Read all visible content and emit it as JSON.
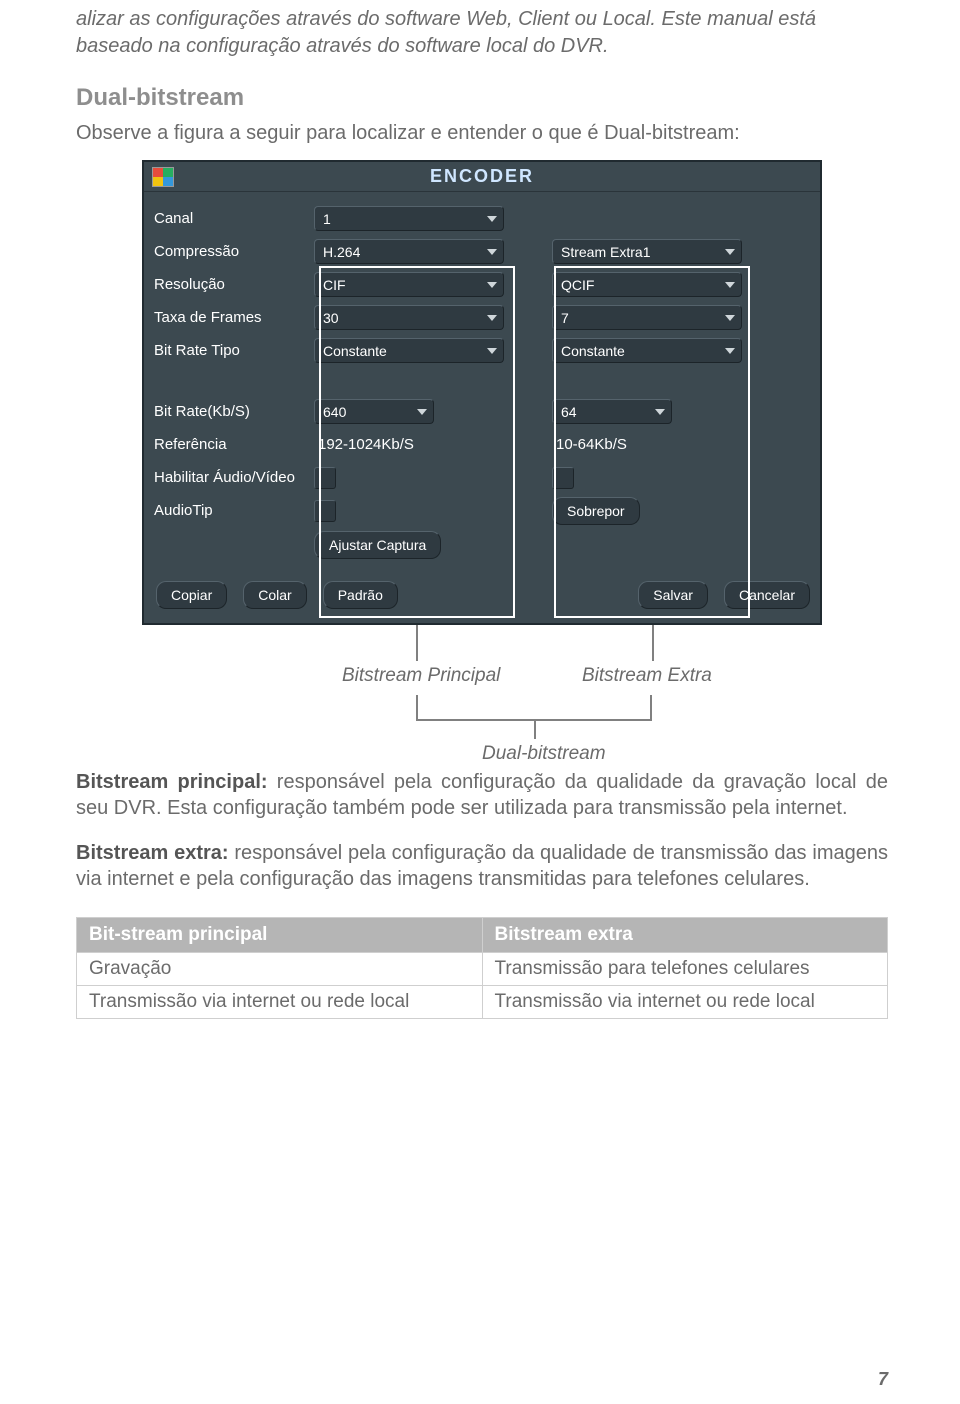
{
  "intro": "alizar as configurações através do software Web, Client ou Local. Este manual está baseado na configuração através do software local do DVR.",
  "section_title": "Dual-bitstream",
  "lead": "Observe a figura a seguir para localizar e entender o que é Dual-bitstream:",
  "encoder": {
    "title": "ENCODER",
    "labels": {
      "canal": "Canal",
      "compressao": "Compressão",
      "resolucao": "Resolução",
      "taxa_frames": "Taxa de Frames",
      "bitrate_tipo": "Bit Rate Tipo",
      "bitrate_kbs": "Bit Rate(Kb/S)",
      "referencia": "Referência",
      "hab_av": "Habilitar Áudio/Vídeo",
      "audiotip": "AudioTip"
    },
    "col1": {
      "canal": "1",
      "compressao": "H.264",
      "resolucao": "CIF",
      "taxa_frames": "30",
      "bitrate_tipo": "Constante",
      "bitrate_kbs": "640",
      "referencia": "192-1024Kb/S"
    },
    "col2": {
      "stream": "Stream Extra1",
      "resolucao": "QCIF",
      "taxa_frames": "7",
      "bitrate_tipo": "Constante",
      "bitrate_kbs": "64",
      "referencia": "10-64Kb/S",
      "sobrepor": "Sobrepor"
    },
    "buttons": {
      "ajustar": "Ajustar Captura",
      "copiar": "Copiar",
      "colar": "Colar",
      "padrao": "Padrão",
      "salvar": "Salvar",
      "cancelar": "Cancelar"
    }
  },
  "callouts": {
    "principal": "Bitstream Principal",
    "extra": "Bitstream Extra",
    "dual": "Dual-bitstream"
  },
  "principal_para_bold": "Bitstream principal:",
  "principal_para": " responsável pela configuração da qualidade da gravação local de seu DVR. Esta configuração também pode ser utilizada para transmissão pela internet.",
  "extra_para_bold": "Bitstream extra:",
  "extra_para": " responsável pela configuração da qualidade de transmissão das imagens via internet e pela configuração das imagens transmitidas para telefones celulares.",
  "table": {
    "h1": "Bit-stream principal",
    "h2": "Bitstream extra",
    "r1c1": "Gravação",
    "r1c2": "Transmissão para telefones celulares",
    "r2c1": "Transmissão via internet ou rede local",
    "r2c2": "Transmissão via internet ou rede local"
  },
  "page_number": "7"
}
